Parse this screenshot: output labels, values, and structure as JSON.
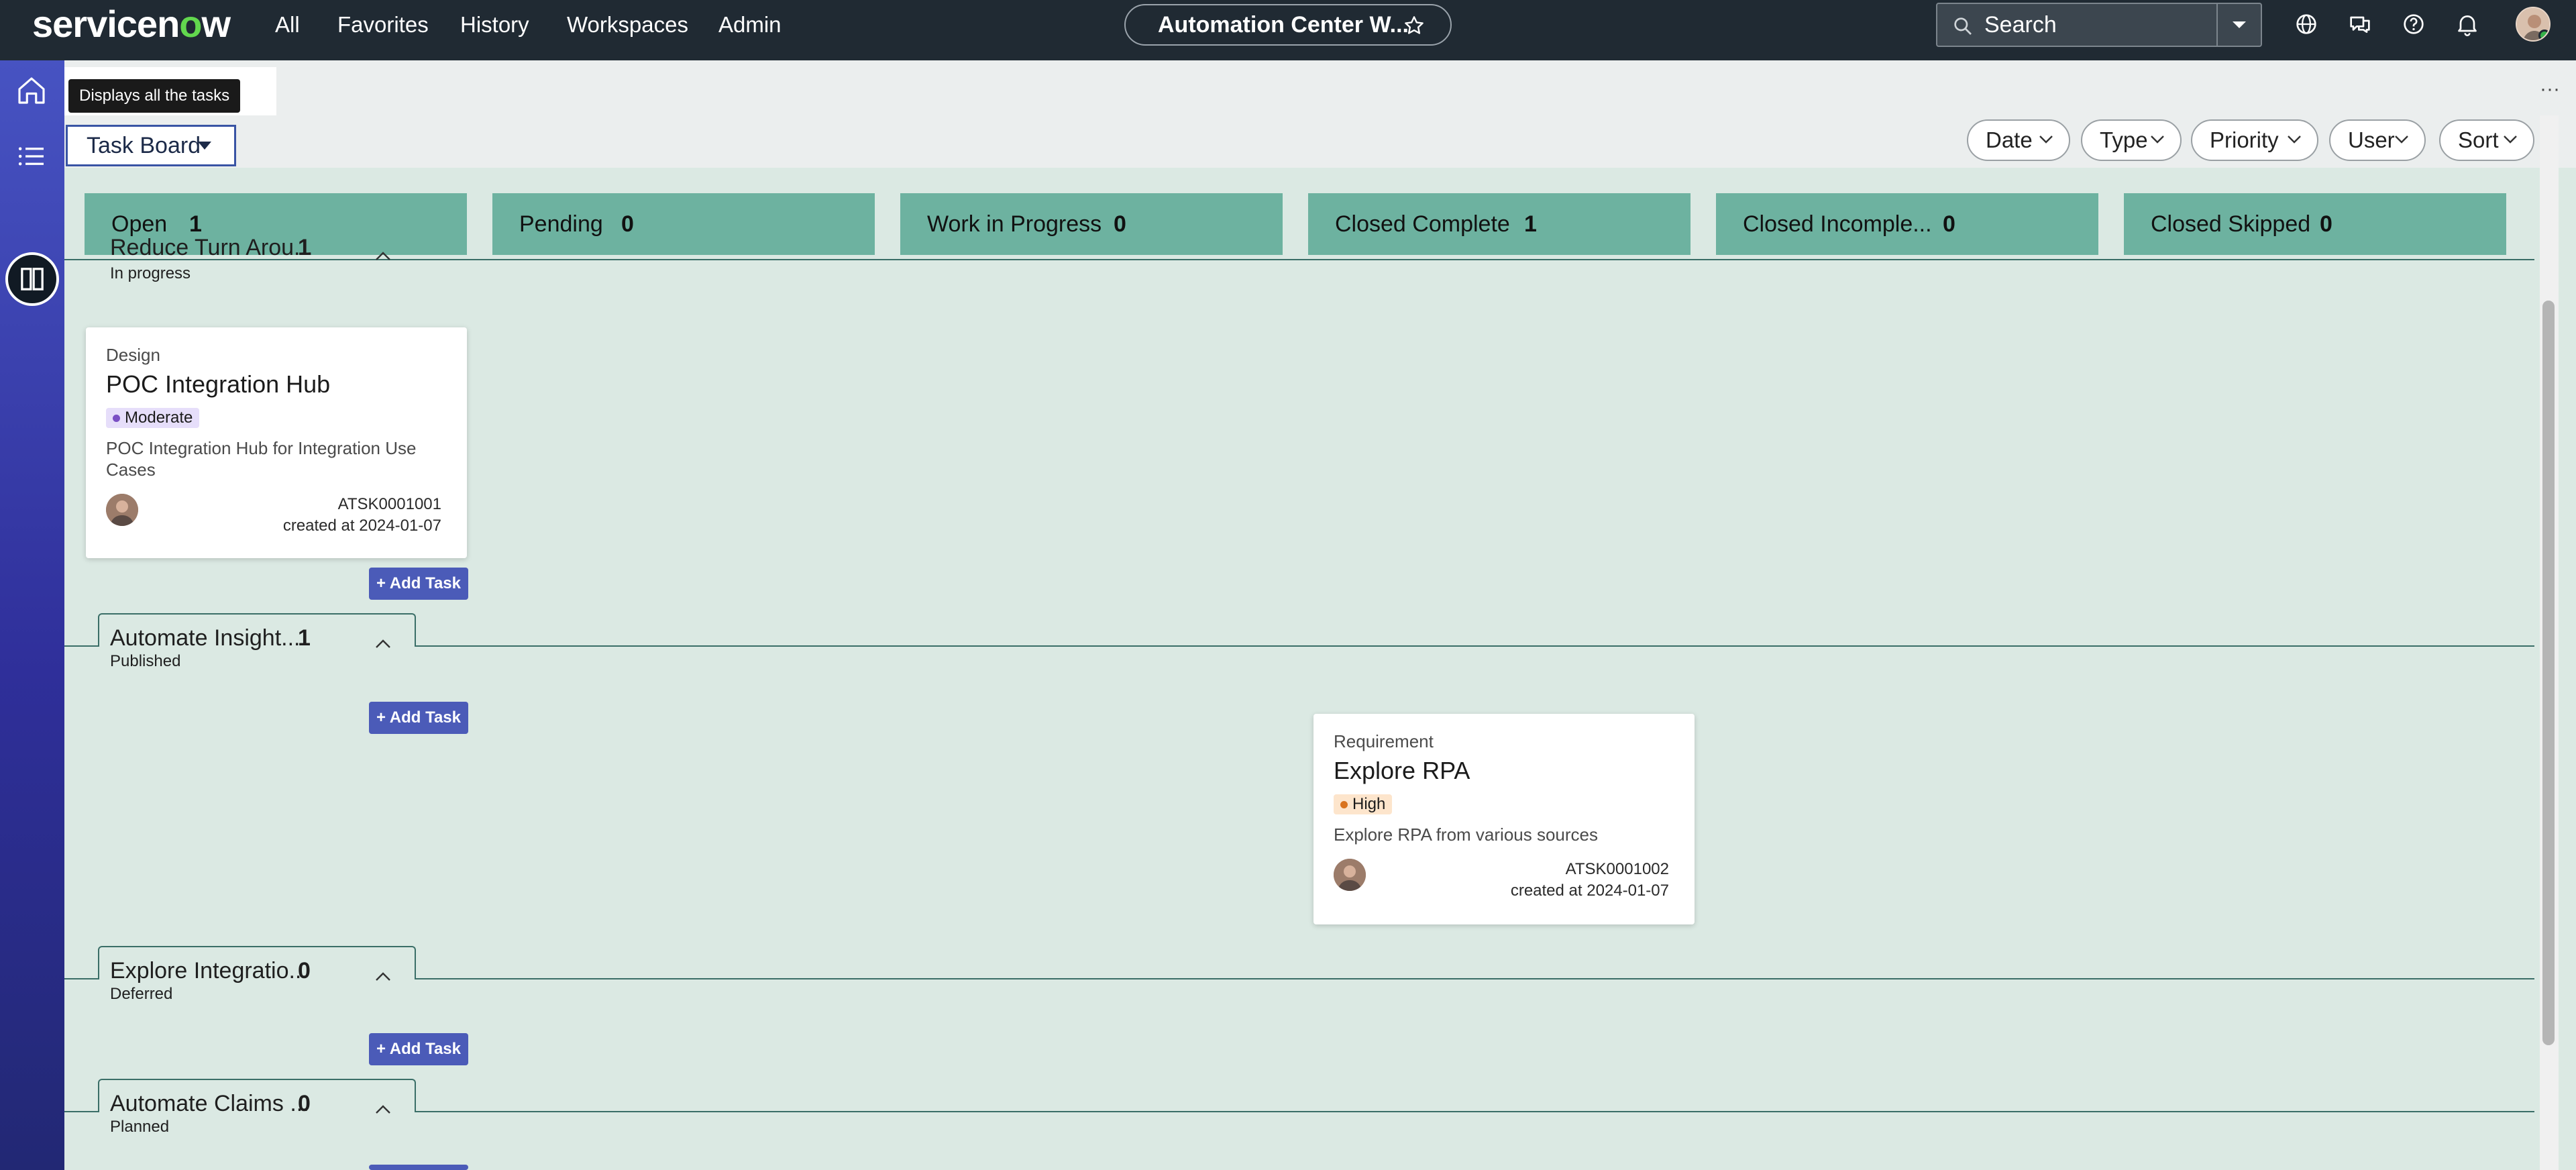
{
  "header": {
    "logo": {
      "pre": "servicen",
      "o": "o",
      "post": "w"
    },
    "nav": [
      "All",
      "Favorites",
      "History",
      "Workspaces",
      "Admin"
    ],
    "center_title": "Automation Center W...",
    "search_placeholder": "Search"
  },
  "tooltip": "Displays all the tasks",
  "toolbar": {
    "view_label": "Task Board",
    "filters": [
      "Date",
      "Type",
      "Priority",
      "User",
      "Sort"
    ]
  },
  "columns": [
    {
      "label": "Open",
      "count": "1"
    },
    {
      "label": "Pending",
      "count": "0"
    },
    {
      "label": "Work in Progress",
      "count": "0"
    },
    {
      "label": "Closed Complete",
      "count": "1"
    },
    {
      "label": "Closed Incomple...",
      "count": "0"
    },
    {
      "label": "Closed Skipped",
      "count": "0"
    }
  ],
  "lanes": [
    {
      "title": "Reduce Turn Arou...",
      "count": "1",
      "status": "In progress"
    },
    {
      "title": "Automate Insight...",
      "count": "1",
      "status": "Published"
    },
    {
      "title": "Explore Integratio...",
      "count": "0",
      "status": "Deferred"
    },
    {
      "title": "Automate Claims ...",
      "count": "0",
      "status": "Planned"
    }
  ],
  "add_task_label": "+ Add Task",
  "cards": [
    {
      "type": "Design",
      "title": "POC Integration Hub",
      "priority": "Moderate",
      "priority_color": "#7a4fc4",
      "priority_bg": "#e6defa",
      "description_line1": "POC Integration Hub for Integration Use",
      "description_line2": "Cases",
      "number": "ATSK0001001",
      "created": "created at 2024-01-07"
    },
    {
      "type": "Requirement",
      "title": "Explore RPA",
      "priority": "High",
      "priority_color": "#d9731e",
      "priority_bg": "#fde5cc",
      "description_line1": "Explore RPA from various sources",
      "number": "ATSK0001002",
      "created": "created at 2024-01-07"
    }
  ],
  "colors": {
    "header_bg": "#202a33",
    "rail": "#4753c2",
    "column_head": "#6db2a0",
    "board_bg": "#dbe9e3",
    "add_task": "#4b5bb8"
  }
}
